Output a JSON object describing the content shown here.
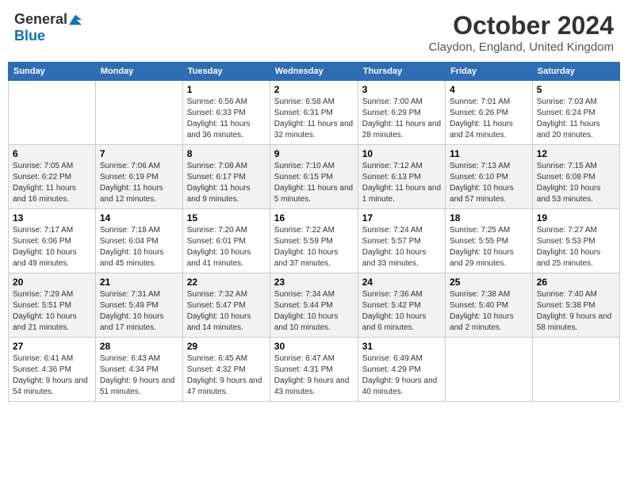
{
  "header": {
    "logo_general": "General",
    "logo_blue": "Blue",
    "month_title": "October 2024",
    "location": "Claydon, England, United Kingdom"
  },
  "days_of_week": [
    "Sunday",
    "Monday",
    "Tuesday",
    "Wednesday",
    "Thursday",
    "Friday",
    "Saturday"
  ],
  "weeks": [
    [
      {
        "day": "",
        "info": ""
      },
      {
        "day": "",
        "info": ""
      },
      {
        "day": "1",
        "info": "Sunrise: 6:56 AM\nSunset: 6:33 PM\nDaylight: 11 hours and 36 minutes."
      },
      {
        "day": "2",
        "info": "Sunrise: 6:58 AM\nSunset: 6:31 PM\nDaylight: 11 hours and 32 minutes."
      },
      {
        "day": "3",
        "info": "Sunrise: 7:00 AM\nSunset: 6:29 PM\nDaylight: 11 hours and 28 minutes."
      },
      {
        "day": "4",
        "info": "Sunrise: 7:01 AM\nSunset: 6:26 PM\nDaylight: 11 hours and 24 minutes."
      },
      {
        "day": "5",
        "info": "Sunrise: 7:03 AM\nSunset: 6:24 PM\nDaylight: 11 hours and 20 minutes."
      }
    ],
    [
      {
        "day": "6",
        "info": "Sunrise: 7:05 AM\nSunset: 6:22 PM\nDaylight: 11 hours and 16 minutes."
      },
      {
        "day": "7",
        "info": "Sunrise: 7:06 AM\nSunset: 6:19 PM\nDaylight: 11 hours and 12 minutes."
      },
      {
        "day": "8",
        "info": "Sunrise: 7:08 AM\nSunset: 6:17 PM\nDaylight: 11 hours and 9 minutes."
      },
      {
        "day": "9",
        "info": "Sunrise: 7:10 AM\nSunset: 6:15 PM\nDaylight: 11 hours and 5 minutes."
      },
      {
        "day": "10",
        "info": "Sunrise: 7:12 AM\nSunset: 6:13 PM\nDaylight: 11 hours and 1 minute."
      },
      {
        "day": "11",
        "info": "Sunrise: 7:13 AM\nSunset: 6:10 PM\nDaylight: 10 hours and 57 minutes."
      },
      {
        "day": "12",
        "info": "Sunrise: 7:15 AM\nSunset: 6:08 PM\nDaylight: 10 hours and 53 minutes."
      }
    ],
    [
      {
        "day": "13",
        "info": "Sunrise: 7:17 AM\nSunset: 6:06 PM\nDaylight: 10 hours and 49 minutes."
      },
      {
        "day": "14",
        "info": "Sunrise: 7:18 AM\nSunset: 6:04 PM\nDaylight: 10 hours and 45 minutes."
      },
      {
        "day": "15",
        "info": "Sunrise: 7:20 AM\nSunset: 6:01 PM\nDaylight: 10 hours and 41 minutes."
      },
      {
        "day": "16",
        "info": "Sunrise: 7:22 AM\nSunset: 5:59 PM\nDaylight: 10 hours and 37 minutes."
      },
      {
        "day": "17",
        "info": "Sunrise: 7:24 AM\nSunset: 5:57 PM\nDaylight: 10 hours and 33 minutes."
      },
      {
        "day": "18",
        "info": "Sunrise: 7:25 AM\nSunset: 5:55 PM\nDaylight: 10 hours and 29 minutes."
      },
      {
        "day": "19",
        "info": "Sunrise: 7:27 AM\nSunset: 5:53 PM\nDaylight: 10 hours and 25 minutes."
      }
    ],
    [
      {
        "day": "20",
        "info": "Sunrise: 7:29 AM\nSunset: 5:51 PM\nDaylight: 10 hours and 21 minutes."
      },
      {
        "day": "21",
        "info": "Sunrise: 7:31 AM\nSunset: 5:49 PM\nDaylight: 10 hours and 17 minutes."
      },
      {
        "day": "22",
        "info": "Sunrise: 7:32 AM\nSunset: 5:47 PM\nDaylight: 10 hours and 14 minutes."
      },
      {
        "day": "23",
        "info": "Sunrise: 7:34 AM\nSunset: 5:44 PM\nDaylight: 10 hours and 10 minutes."
      },
      {
        "day": "24",
        "info": "Sunrise: 7:36 AM\nSunset: 5:42 PM\nDaylight: 10 hours and 6 minutes."
      },
      {
        "day": "25",
        "info": "Sunrise: 7:38 AM\nSunset: 5:40 PM\nDaylight: 10 hours and 2 minutes."
      },
      {
        "day": "26",
        "info": "Sunrise: 7:40 AM\nSunset: 5:38 PM\nDaylight: 9 hours and 58 minutes."
      }
    ],
    [
      {
        "day": "27",
        "info": "Sunrise: 6:41 AM\nSunset: 4:36 PM\nDaylight: 9 hours and 54 minutes."
      },
      {
        "day": "28",
        "info": "Sunrise: 6:43 AM\nSunset: 4:34 PM\nDaylight: 9 hours and 51 minutes."
      },
      {
        "day": "29",
        "info": "Sunrise: 6:45 AM\nSunset: 4:32 PM\nDaylight: 9 hours and 47 minutes."
      },
      {
        "day": "30",
        "info": "Sunrise: 6:47 AM\nSunset: 4:31 PM\nDaylight: 9 hours and 43 minutes."
      },
      {
        "day": "31",
        "info": "Sunrise: 6:49 AM\nSunset: 4:29 PM\nDaylight: 9 hours and 40 minutes."
      },
      {
        "day": "",
        "info": ""
      },
      {
        "day": "",
        "info": ""
      }
    ]
  ]
}
